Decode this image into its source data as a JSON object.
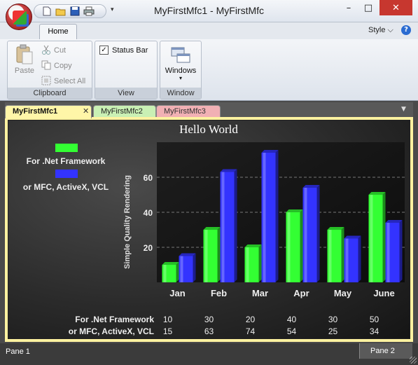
{
  "window": {
    "title": "MyFirstMfc1 - MyFirstMfc",
    "minimize": "–",
    "maximize": "□",
    "close": "✕"
  },
  "qat_more": "▾",
  "ribbon": {
    "tabs": [
      {
        "label": "Home"
      }
    ],
    "style_menu": "Style",
    "style_chevron": "⌵",
    "help": "?",
    "groups": {
      "clipboard": {
        "label": "Clipboard",
        "paste": "Paste",
        "cut": "Cut",
        "copy": "Copy",
        "select_all": "Select All"
      },
      "view": {
        "label": "View",
        "status_bar": "Status Bar",
        "status_bar_checked": "✓"
      },
      "window": {
        "label": "Window",
        "windows": "Windows",
        "windows_arrow": "▾"
      }
    }
  },
  "doc_tabs": [
    {
      "label": "MyFirstMfc1",
      "close": "✕",
      "active": true
    },
    {
      "label": "MyFirstMfc2"
    },
    {
      "label": "MyFirstMfc3"
    }
  ],
  "doc_tabs_dropdown": "▼",
  "chart_data": {
    "type": "bar",
    "title": "Hello World",
    "ylabel": "Simple Quality Rendering",
    "xlabel": "",
    "categories": [
      "Jan",
      "Feb",
      "Mar",
      "Apr",
      "May",
      "June"
    ],
    "series": [
      {
        "name": "For .Net Framework",
        "values": [
          10,
          30,
          20,
          40,
          30,
          50
        ],
        "color": "#33ff33"
      },
      {
        "name": "or MFC, ActiveX, VCL",
        "values": [
          15,
          63,
          74,
          54,
          25,
          34
        ],
        "color": "#3333ff"
      }
    ],
    "ylim": [
      0,
      80
    ],
    "yticks": [
      20,
      40,
      60
    ],
    "grid": true,
    "legend": "left",
    "data_table": true
  },
  "status": {
    "pane1": "Pane 1",
    "pane2": "Pane 2"
  }
}
